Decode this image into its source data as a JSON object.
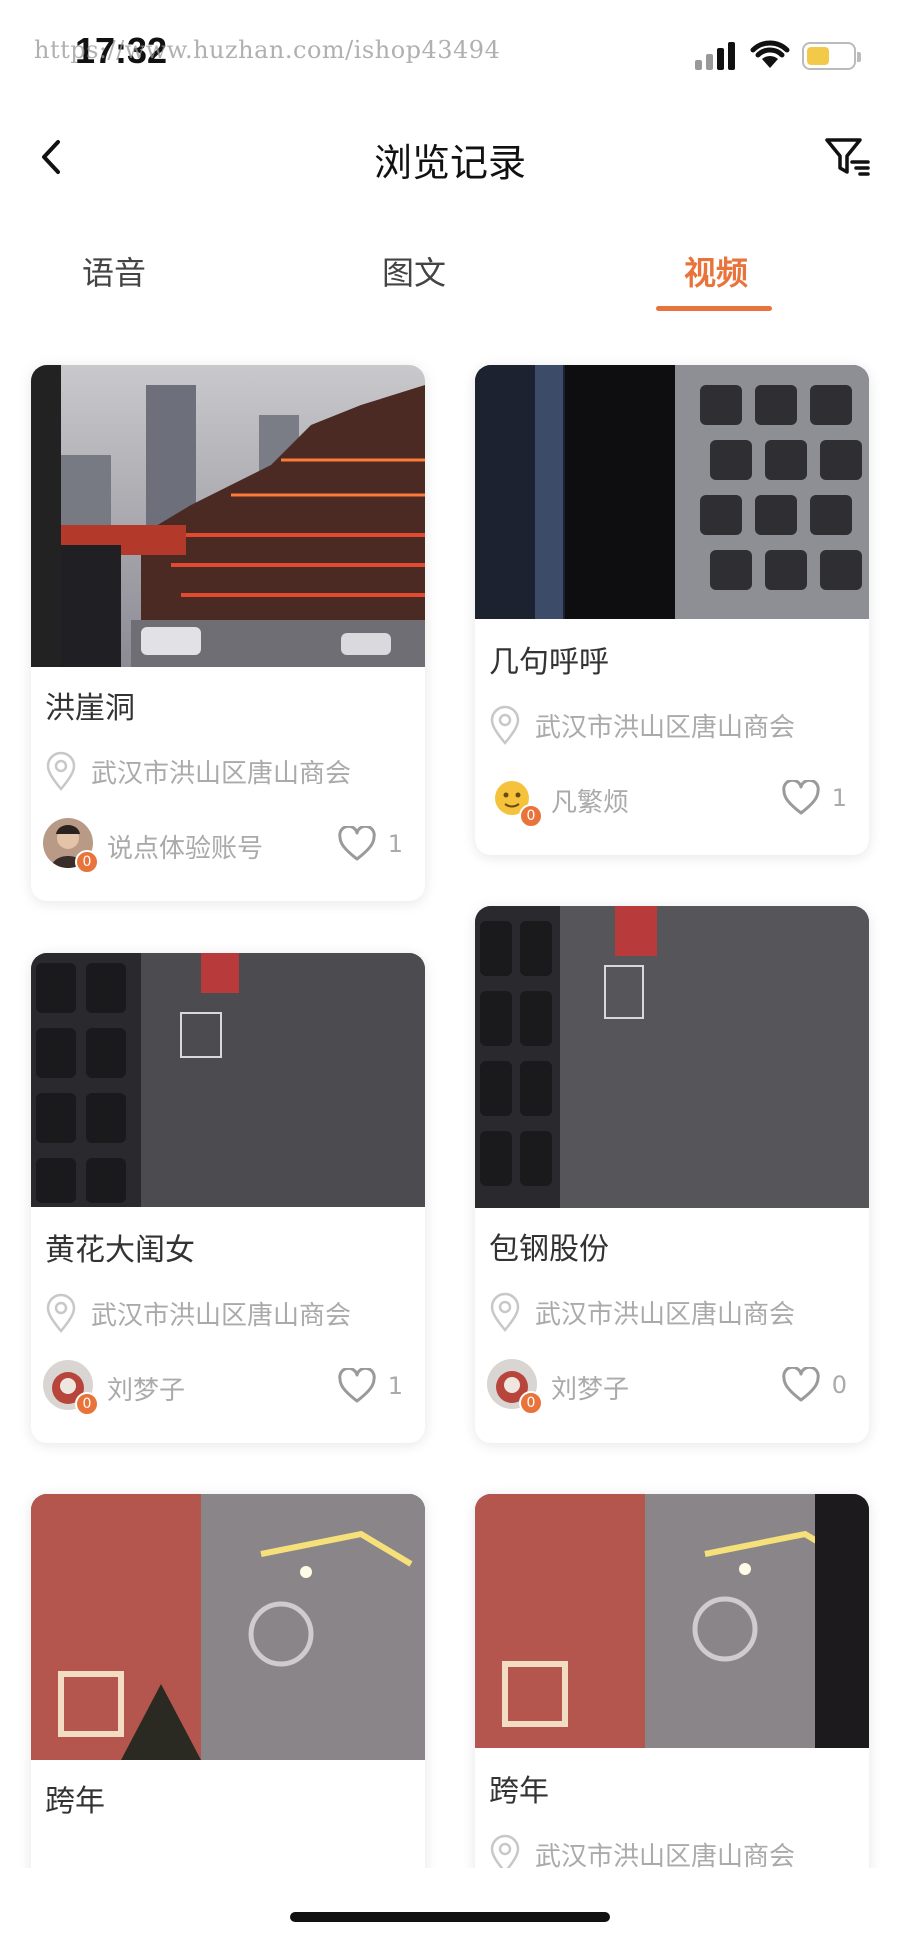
{
  "status_bar": {
    "time": "17:32",
    "watermark": "https://www.huzhan.com/ishop43494"
  },
  "nav": {
    "title": "浏览记录",
    "back_icon": "chevron-left-icon",
    "filter_icon": "filter-icon"
  },
  "tabs": [
    {
      "label": "语音",
      "active": false
    },
    {
      "label": "图文",
      "active": false
    },
    {
      "label": "视频",
      "active": true
    }
  ],
  "accent_color": "#e8743b",
  "cards": [
    {
      "title": "洪崖洞",
      "location": "武汉市洪山区唐山商会",
      "author": "说点体验账号",
      "badge": "0",
      "likes": "1"
    },
    {
      "title": "几句呼呼",
      "location": "武汉市洪山区唐山商会",
      "author": "凡繁烦",
      "badge": "0",
      "likes": "1"
    },
    {
      "title": "黄花大闺女",
      "location": "武汉市洪山区唐山商会",
      "author": "刘梦子",
      "badge": "0",
      "likes": "1"
    },
    {
      "title": "包钢股份",
      "location": "武汉市洪山区唐山商会",
      "author": "刘梦子",
      "badge": "0",
      "likes": "0"
    },
    {
      "title": "跨年"
    },
    {
      "title": "跨年",
      "location": "武汉市洪山区唐山商会"
    }
  ]
}
